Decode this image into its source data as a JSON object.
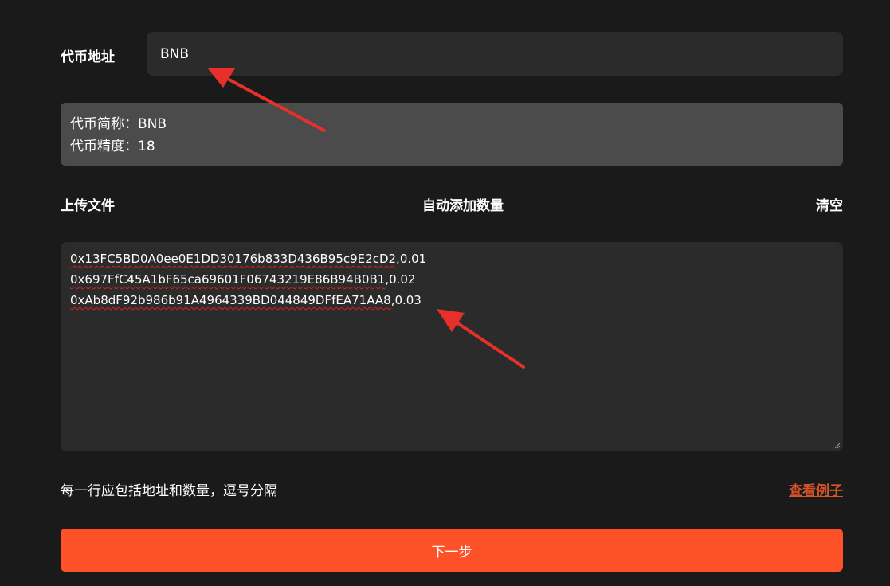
{
  "address_row": {
    "label": "代币地址",
    "value": "BNB"
  },
  "token_info": {
    "symbol_line": "代币简称：BNB",
    "decimals_line": "代币精度：18"
  },
  "toolbar": {
    "upload_label": "上传文件",
    "auto_add_label": "自动添加数量",
    "clear_label": "清空"
  },
  "entries": [
    {
      "address": "0x13FC5BD0A0ee0E1DD30176b833D436B95c9E2cD2",
      "amount": ",0.01"
    },
    {
      "address": "0x697FfC45A1bF65ca69601F06743219E86B94B0B1",
      "amount": ",0.02"
    },
    {
      "address": "0xAb8dF92b986b91A4964339BD044849DFfEA71AA8",
      "amount": ",0.03"
    }
  ],
  "hint": {
    "text": "每一行应包括地址和数量，逗号分隔",
    "example_link": "查看例子"
  },
  "next_button": {
    "label": "下一步"
  },
  "colors": {
    "background": "#1a1a1a",
    "input_bg": "#2b2b2b",
    "info_bg": "#4b4b4b",
    "accent": "#ff5128",
    "link": "#d9532a",
    "annotation_arrow": "#e8302a"
  },
  "annotations": [
    "arrow-icon",
    "arrow-icon"
  ]
}
